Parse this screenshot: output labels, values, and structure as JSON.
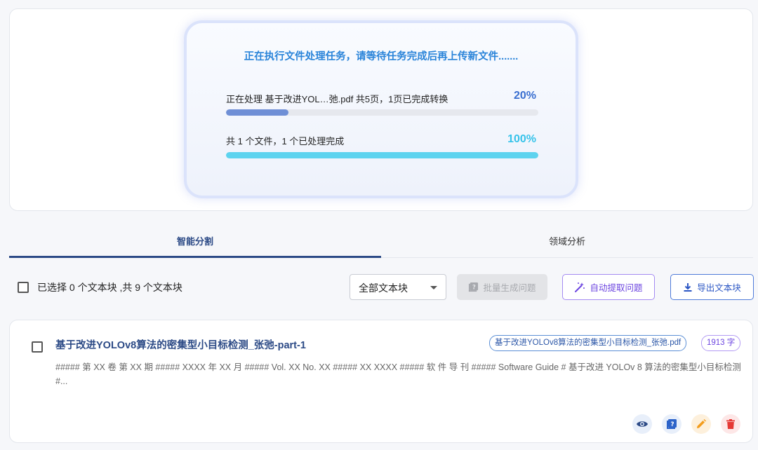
{
  "processing": {
    "title": "正在执行文件处理任务，请等待任务完成后再上传新文件.......",
    "file_progress": {
      "label": "正在处理 基于改进YOL…弛.pdf 共5页，1页已完成转换",
      "percent_text": "20%",
      "value": 0.2,
      "color": "#6f8fd6"
    },
    "total_progress": {
      "label": "共 1 个文件，1 个已处理完成",
      "percent_text": "100%",
      "value": 1.0,
      "color": "#5dd3ef"
    }
  },
  "tabs": [
    {
      "label": "智能分割",
      "active": true
    },
    {
      "label": "领域分析",
      "active": false
    }
  ],
  "toolbar": {
    "selection_text": "已选择 0 个文本块 ,共 9 个文本块",
    "filter_value": "全部文本块",
    "batch_generate_label": "批量生成问题",
    "auto_extract_label": "自动提取问题",
    "export_label": "导出文本块"
  },
  "chunk": {
    "title": "基于改进YOLOv8算法的密集型小目标检测_张弛-part-1",
    "file_chip": "基于改进YOLOv8算法的密集型小目标检测_张弛.pdf",
    "count_chip": "1913 字",
    "preview": "##### 第 XX 卷 第 XX 期 ##### XXXX 年 XX 月 ##### Vol. XX No. XX ##### XX XXXX ##### 软 件 导 刊 ##### Software Guide # 基于改进 YOLOv 8 算法的密集型小目标检测 #...",
    "actions": [
      "eye-icon",
      "question-icon",
      "edit-icon",
      "delete-icon"
    ]
  },
  "colors": {
    "accent": "#2c4a86",
    "title_blue": "#2a84d9",
    "purple": "#6c45e0",
    "orange": "#f39c1c",
    "red": "#e53935"
  }
}
